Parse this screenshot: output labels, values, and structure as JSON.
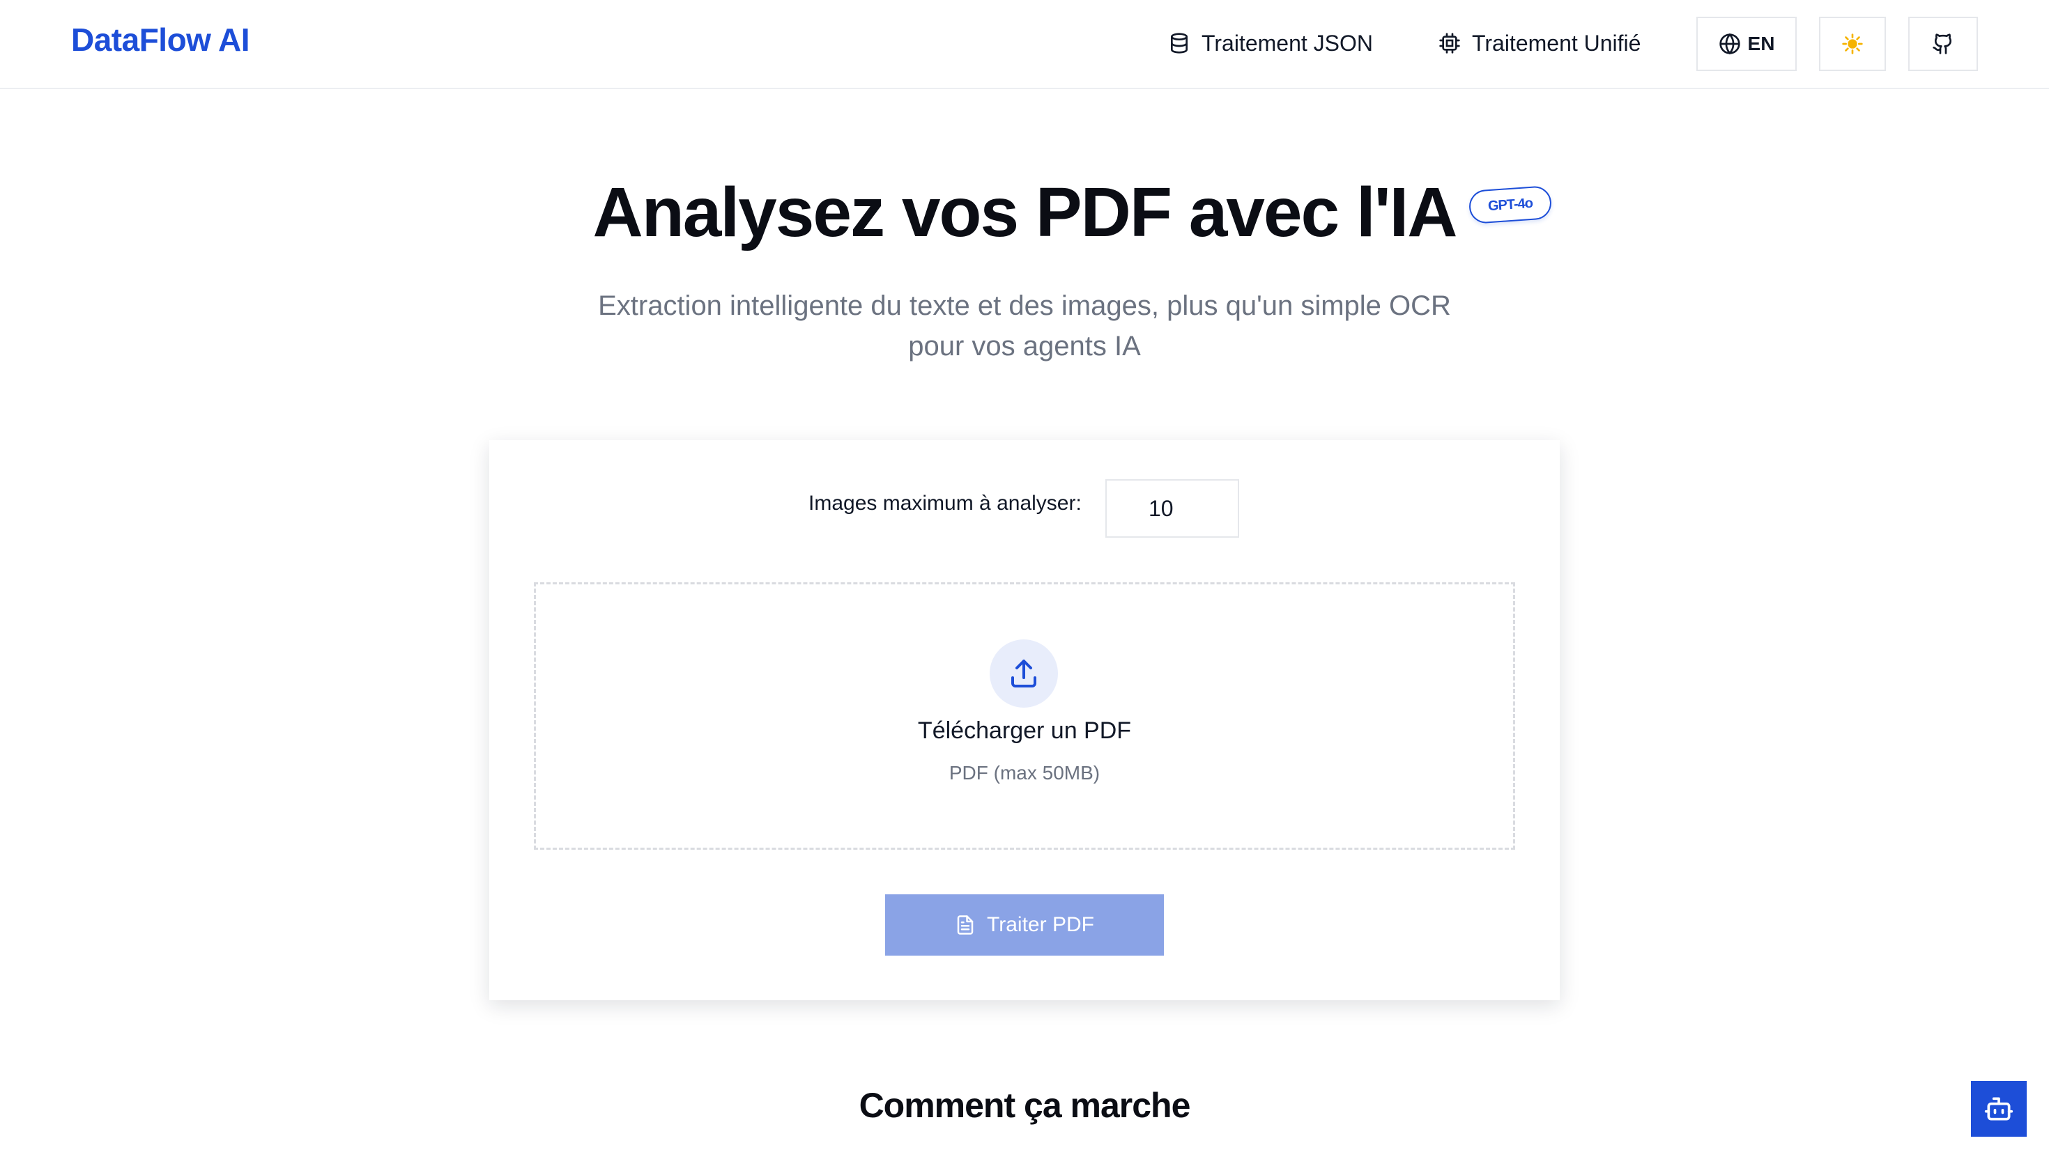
{
  "header": {
    "brand": "DataFlow AI",
    "nav": [
      {
        "label": "Traitement JSON",
        "icon": "database-icon"
      },
      {
        "label": "Traitement Unifié",
        "icon": "cpu-icon"
      }
    ],
    "language_button": {
      "label": "EN",
      "icon": "globe-icon"
    },
    "theme_toggle_icon": "sun-icon",
    "github_icon": "github-icon"
  },
  "hero": {
    "title": "Analysez vos PDF avec l'IA",
    "badge": "GPT-4o",
    "subtitle_line1": "Extraction intelligente du texte et des images, plus qu'un simple OCR",
    "subtitle_line2": "pour vos agents IA"
  },
  "upload_card": {
    "max_images_label": "Images maximum à analyser:",
    "max_images_value": "10",
    "dropzone_title": "Télécharger un PDF",
    "dropzone_hint": "PDF (max 50MB)",
    "process_button": "Traiter PDF"
  },
  "how_it_works": {
    "title": "Comment ça marche"
  },
  "colors": {
    "accent": "#1d4ed8",
    "button_disabled": "#8aa3e6",
    "upload_circle": "#e8edfb"
  }
}
